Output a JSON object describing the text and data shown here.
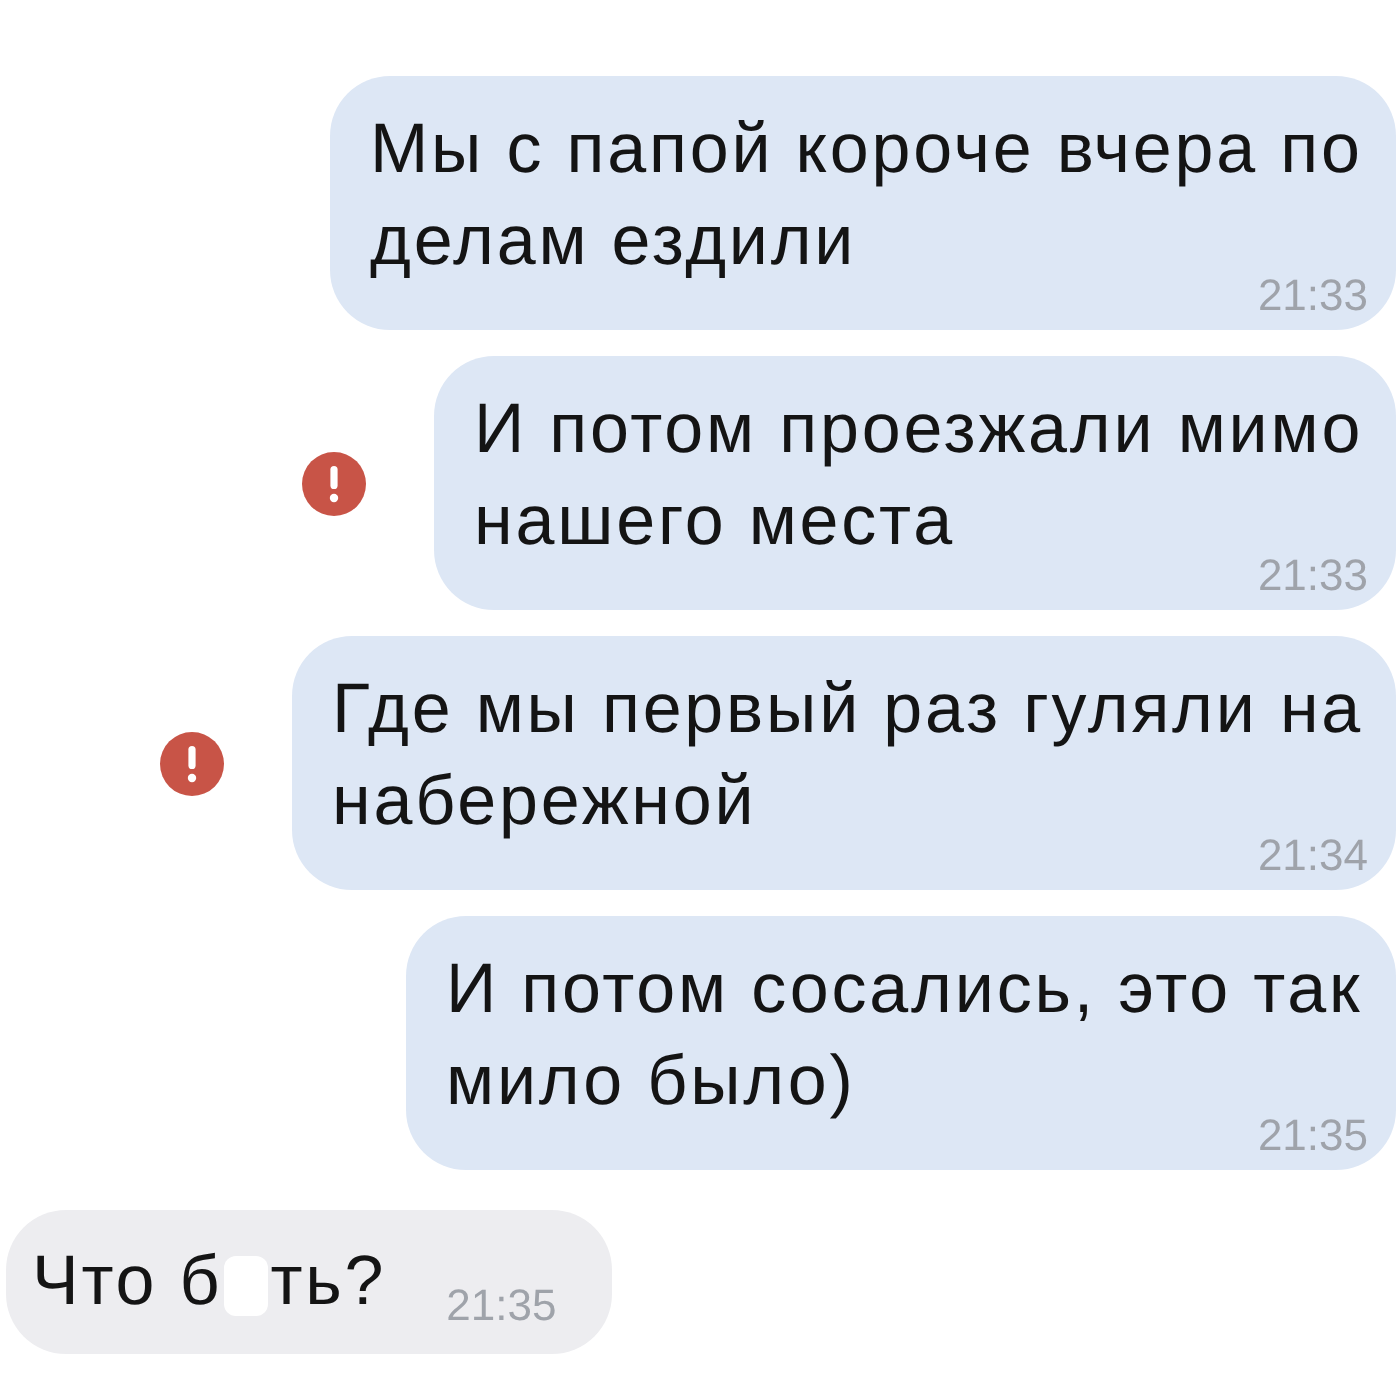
{
  "messages": [
    {
      "kind": "outgoing",
      "text_parts": [
        "Мы с папой короче вчера по делам ездили"
      ],
      "time": "21:33",
      "failed": false
    },
    {
      "kind": "outgoing",
      "text_parts": [
        "И потом проезжали мимо нашего места"
      ],
      "time": "21:33",
      "failed": true
    },
    {
      "kind": "outgoing",
      "text_parts": [
        "Где мы первый раз гуляли на набережной"
      ],
      "time": "21:34",
      "failed": true
    },
    {
      "kind": "outgoing",
      "text_parts": [
        "И потом сосались, это так мило было)"
      ],
      "time": "21:35",
      "failed": false
    },
    {
      "kind": "incoming",
      "text_parts": [
        "Что б",
        "ть?"
      ],
      "censored": true,
      "time": "21:35",
      "failed": false
    }
  ]
}
